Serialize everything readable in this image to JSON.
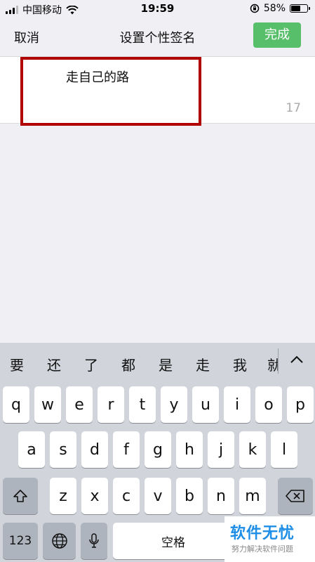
{
  "status_bar": {
    "carrier": "中国移动",
    "time": "19:59",
    "battery_percent": "58%"
  },
  "nav": {
    "cancel": "取消",
    "title": "设置个性签名",
    "done": "完成"
  },
  "editor": {
    "text": "走自己的路",
    "remaining_count": "17"
  },
  "keyboard": {
    "candidates": [
      "要",
      "还",
      "了",
      "都",
      "是",
      "走",
      "我",
      "就"
    ],
    "row1": [
      "q",
      "w",
      "e",
      "r",
      "t",
      "y",
      "u",
      "i",
      "o",
      "p"
    ],
    "row2": [
      "a",
      "s",
      "d",
      "f",
      "g",
      "h",
      "j",
      "k",
      "l"
    ],
    "row3": [
      "z",
      "x",
      "c",
      "v",
      "b",
      "n",
      "m"
    ],
    "numbers_key": "123",
    "space_key": "空格"
  },
  "watermark": {
    "title": "软件无忧",
    "subtitle": "努力解决软件问题"
  },
  "colors": {
    "done_button": "#57be6a",
    "highlight_border": "#b00000",
    "keyboard_bg": "#d1d5db",
    "watermark_text": "#1e8ee6"
  }
}
